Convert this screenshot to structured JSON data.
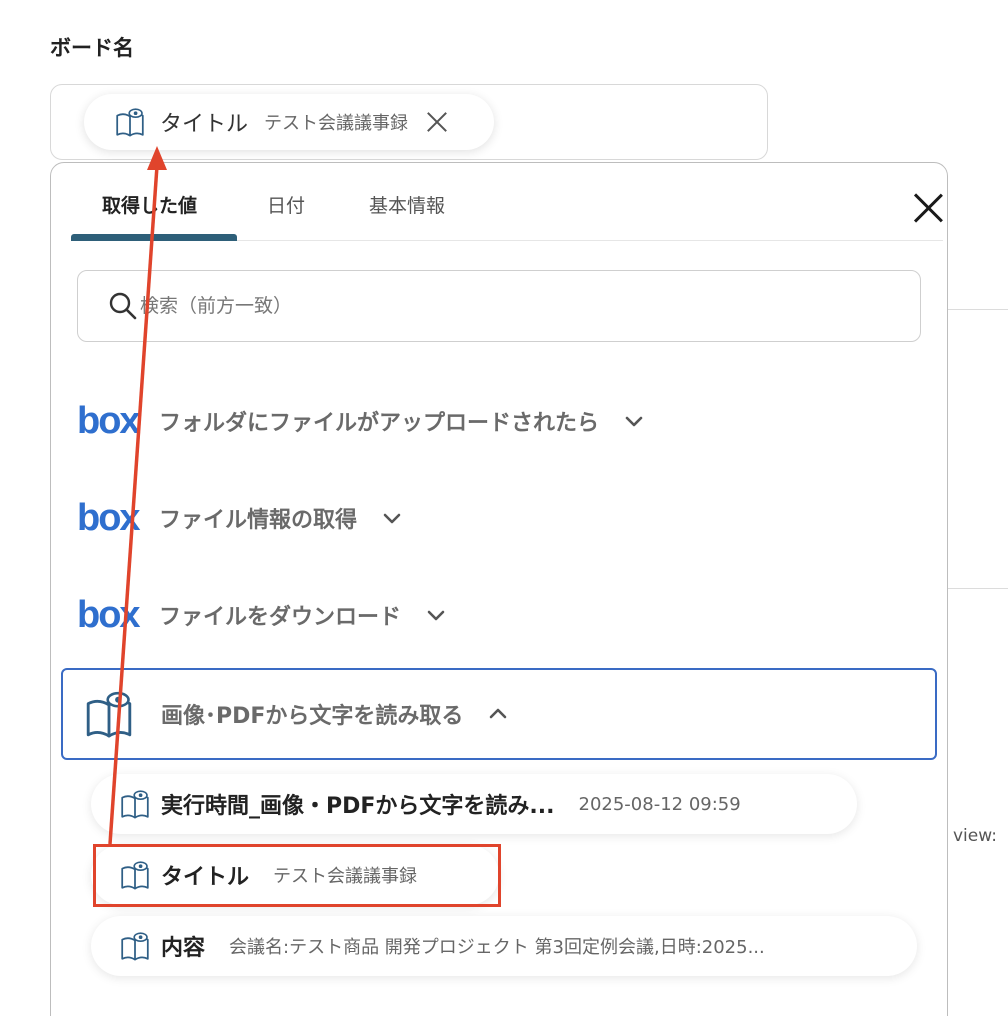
{
  "field": {
    "label": "ボード名"
  },
  "chip": {
    "title": "タイトル",
    "value": "テスト会議議事録"
  },
  "background": {
    "cut_text": "view:"
  },
  "tabs": [
    {
      "label": "取得した値",
      "active": true
    },
    {
      "label": "日付",
      "active": false
    },
    {
      "label": "基本情報",
      "active": false
    }
  ],
  "search": {
    "placeholder": "検索（前方一致）",
    "value": ""
  },
  "sections": [
    {
      "logo": "box",
      "label": "フォルダにファイルがアップロードされたら",
      "icon": "chevron-down-icon"
    },
    {
      "logo": "box",
      "label": "ファイル情報の取得",
      "icon": "chevron-down-icon"
    },
    {
      "logo": "box",
      "label": "ファイルをダウンロード",
      "icon": "chevron-down-icon"
    },
    {
      "logo": "ocr-book-icon",
      "label": "画像･PDFから文字を読み取る",
      "icon": "chevron-up-icon",
      "expanded": true
    }
  ],
  "items": [
    {
      "title": "実行時間_画像・PDFから文字を読み...",
      "value": "2025-08-12 09:59"
    },
    {
      "title": "タイトル",
      "value": "テスト会議議事録",
      "highlighted": true
    },
    {
      "title": "内容",
      "value": "会議名:テスト商品 開発プロジェクト 第3回定例会議,日時:2025..."
    }
  ],
  "colors": {
    "accent": "#2e5f79",
    "box_blue": "#2f6fce",
    "selected_border": "#3a6bc4",
    "annotation": "#e0442c"
  }
}
